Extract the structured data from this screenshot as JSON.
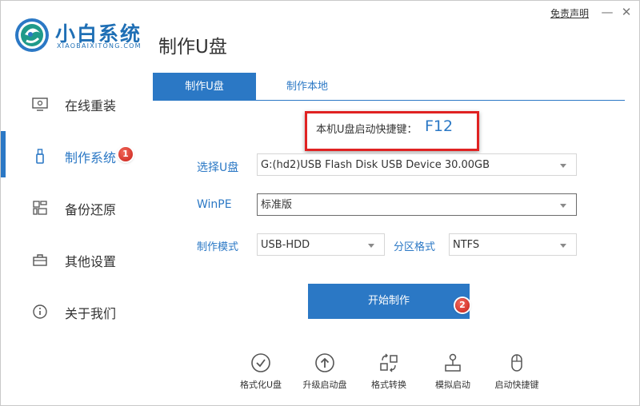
{
  "app": {
    "name": "小白系统",
    "subtitle": "XIAOBAIXITONG.COM",
    "page_title": "制作U盘"
  },
  "window": {
    "disclaimer": "免责声明",
    "minimize": "—",
    "close": "✕"
  },
  "sidebar": {
    "items": [
      {
        "label": "在线重装",
        "icon": "monitor-icon"
      },
      {
        "label": "制作系统",
        "icon": "usb-drive-icon",
        "active": true,
        "badge": "1"
      },
      {
        "label": "备份还原",
        "icon": "grid-icon"
      },
      {
        "label": "其他设置",
        "icon": "toolbox-icon"
      },
      {
        "label": "关于我们",
        "icon": "info-icon"
      }
    ]
  },
  "tabs": [
    {
      "label": "制作U盘",
      "active": true
    },
    {
      "label": "制作本地",
      "active": false
    }
  ],
  "hotkey": {
    "label": "本机U盘启动快捷键：",
    "key": "F12"
  },
  "form": {
    "usb_label": "选择U盘",
    "usb_value": "G:(hd2)USB Flash Disk USB Device 30.00GB",
    "winpe_label": "WinPE",
    "winpe_value": "标准版",
    "mode_label": "制作模式",
    "mode_value": "USB-HDD",
    "partition_label": "分区格式",
    "partition_value": "NTFS"
  },
  "start": {
    "label": "开始制作",
    "badge": "2"
  },
  "tools": [
    {
      "label": "格式化U盘",
      "icon": "check-circle-icon"
    },
    {
      "label": "升级启动盘",
      "icon": "arrow-up-circle-icon"
    },
    {
      "label": "格式转换",
      "icon": "convert-icon"
    },
    {
      "label": "模拟启动",
      "icon": "joystick-icon"
    },
    {
      "label": "启动快捷键",
      "icon": "mouse-icon"
    }
  ],
  "colors": {
    "accent": "#2b78c5",
    "highlight": "#e02222",
    "badge": "#d9261c"
  }
}
